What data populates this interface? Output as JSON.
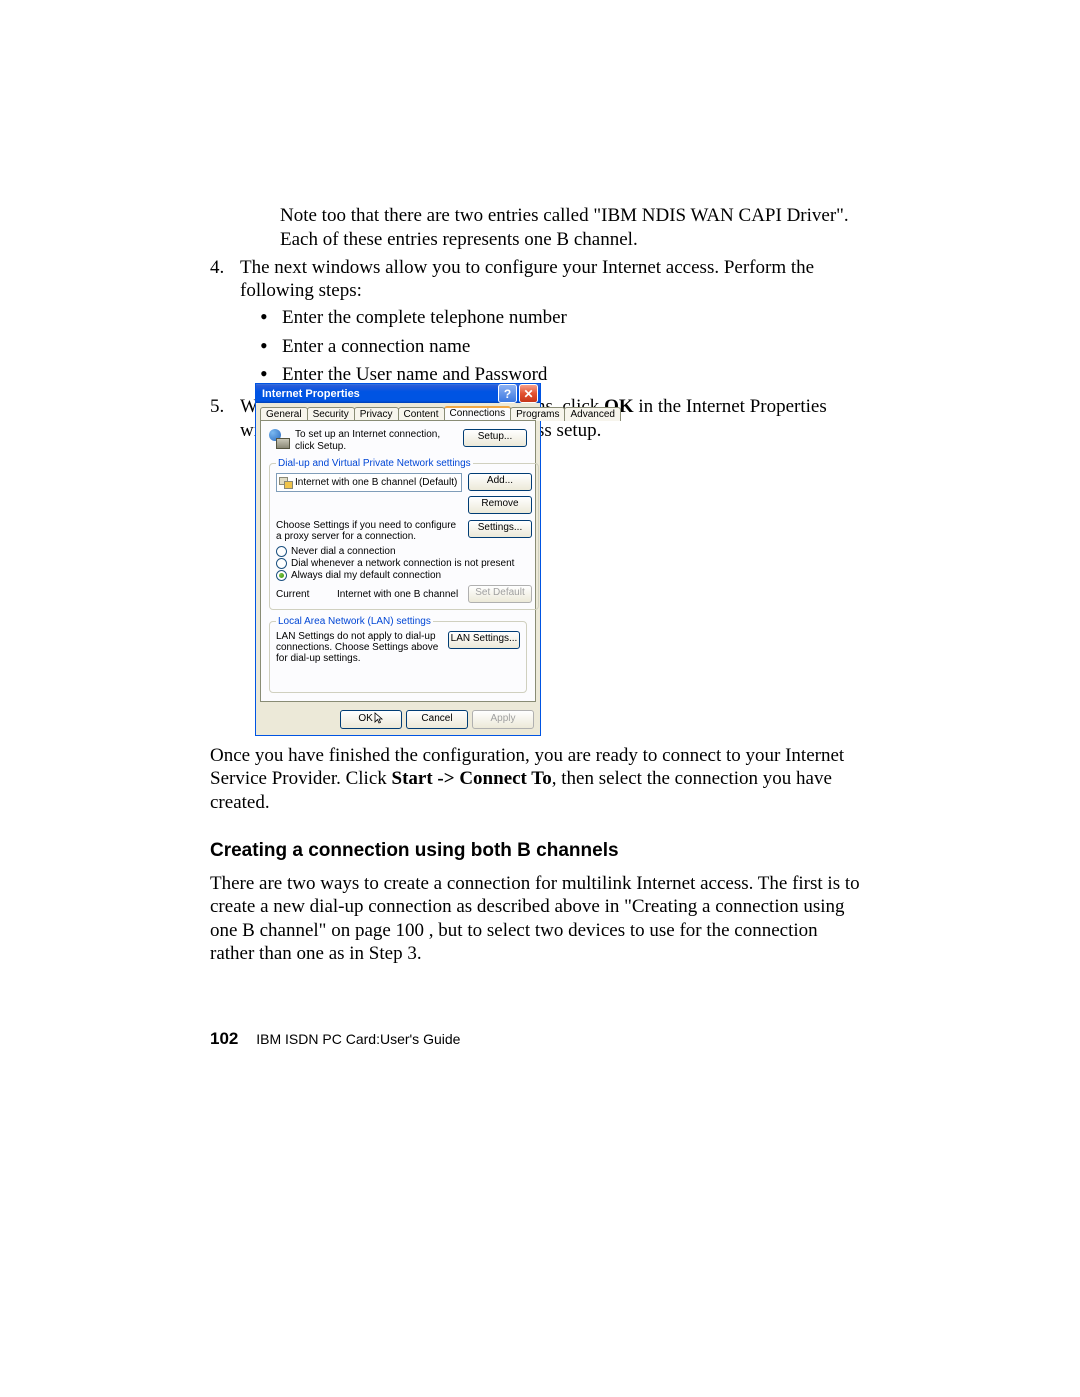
{
  "intro": {
    "note": "Note too that there are two entries called \"IBM NDIS WAN CAPI Driver\". Each of these entries represents one B channel.",
    "step4_num": "4.",
    "step4": "The next windows allow you to configure your Internet access. Perform the following steps:",
    "bul1": "Enter the complete telephone number",
    "bul2": "Enter a connection name",
    "bul3": "Enter the User name and Password",
    "step5_num": "5.",
    "step5_pre": "When you have finished these operations, click ",
    "step5_bold": "OK",
    "step5_post": " in the Internet Properties window to complete your Internet access setup."
  },
  "dialog": {
    "title": "Internet Properties",
    "tabs": [
      "General",
      "Security",
      "Privacy",
      "Content",
      "Connections",
      "Programs",
      "Advanced"
    ],
    "setup_text": "To set up an Internet connection, click Setup.",
    "btn_setup": "Setup...",
    "fs1_legend": "Dial-up and Virtual Private Network settings",
    "list_item": "Internet with one B channel (Default)",
    "btn_add": "Add...",
    "btn_remove": "Remove",
    "proxy_text": "Choose Settings if you need to configure a proxy server for a connection.",
    "btn_settings": "Settings...",
    "r1": "Never dial a connection",
    "r2": "Dial whenever a network connection is not present",
    "r3": "Always dial my default connection",
    "cur_label": "Current",
    "cur_value": "Internet with one B channel",
    "btn_setdefault": "Set Default",
    "fs2_legend": "Local Area Network (LAN) settings",
    "lan_text": "LAN Settings do not apply to dial-up connections. Choose Settings above for dial-up settings.",
    "btn_lan": "LAN Settings...",
    "btn_ok": "OK",
    "btn_cancel": "Cancel",
    "btn_apply": "Apply"
  },
  "after": {
    "p1_pre": "Once you have finished the configuration, you are ready to connect to your Internet Service Provider. Click ",
    "p1_bold": "Start -> Connect To",
    "p1_post": ", then select the connection you have created.",
    "heading": "Creating a connection using both B channels",
    "p2": "There are two ways to create a connection for multilink Internet access. The first is to create a new dial-up connection as described above in \"Creating a connection using one B channel\" on page 100 , but to select two devices to use for the connection rather than one as in Step 3."
  },
  "footer": {
    "page": "102",
    "title": "IBM ISDN PC Card:User's Guide"
  }
}
